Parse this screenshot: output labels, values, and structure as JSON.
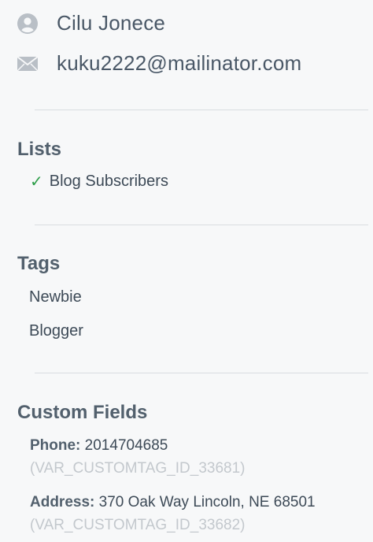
{
  "contact": {
    "name": "Cilu Jonece",
    "email": "kuku2222@mailinator.com",
    "name_icon": "user-icon",
    "email_icon": "envelope-icon"
  },
  "lists": {
    "title": "Lists",
    "items": [
      {
        "label": "Blog Subscribers",
        "icon": "check-icon",
        "checked": true
      }
    ]
  },
  "tags": {
    "title": "Tags",
    "items": [
      "Newbie",
      "Blogger"
    ]
  },
  "custom_fields": {
    "title": "Custom Fields",
    "items": [
      {
        "label": "Phone:",
        "value": "2014704685",
        "var": "(VAR_CUSTOMTAG_ID_33681)"
      },
      {
        "label": "Address:",
        "value": "370 Oak Way Lincoln, NE 68501",
        "var": "(VAR_CUSTOMTAG_ID_33682)"
      }
    ]
  },
  "colors": {
    "check": "#2e9e4a",
    "icon": "#b9bfc6",
    "muted_var": "#c3c8cd",
    "divider": "#d9dde1"
  }
}
